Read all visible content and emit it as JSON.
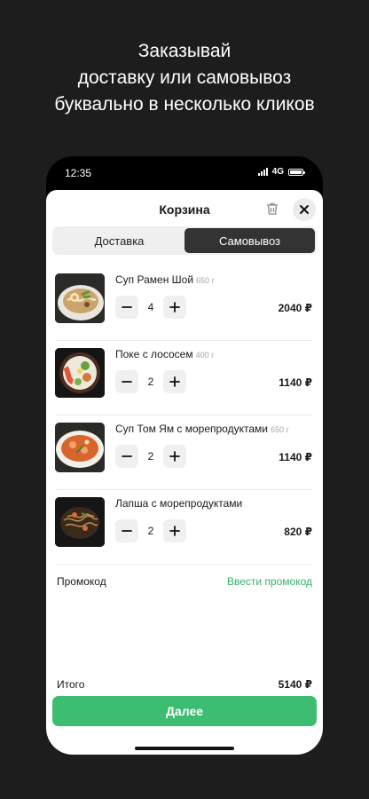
{
  "promo_headline": [
    "Заказывай",
    "доставку или самовывоз",
    "буквально в несколько кликов"
  ],
  "status_bar": {
    "time": "12:35",
    "network": "4G"
  },
  "cart": {
    "title": "Корзина",
    "tabs": [
      {
        "label": "Доставка",
        "active": false
      },
      {
        "label": "Самовывоз",
        "active": true
      }
    ],
    "items": [
      {
        "name": "Суп Рамен Шой",
        "weight": "650 г",
        "quantity": "4",
        "price": "2040 ₽",
        "image": "ramen-bowl"
      },
      {
        "name": "Поке с лососем",
        "weight": "400 г",
        "quantity": "2",
        "price": "1140 ₽",
        "image": "poke-bowl"
      },
      {
        "name": "Суп Том Ям с морепродуктами",
        "weight": "650 г",
        "quantity": "2",
        "price": "1140 ₽",
        "image": "tom-yum-bowl"
      },
      {
        "name": "Лапша с морепродуктами",
        "weight": "",
        "quantity": "2",
        "price": "820 ₽",
        "image": "noodles-plate"
      }
    ],
    "promo_label": "Промокод",
    "promo_link": "Ввести промокод",
    "total_label": "Итого",
    "total_value": "5140 ₽",
    "next_button": "Далее"
  },
  "colors": {
    "background": "#1d1d1d",
    "accent_green": "#3dbd72",
    "promo_link": "#34b366",
    "active_tab": "#333333"
  },
  "icons": {
    "trash": "trash-icon",
    "close": "close-icon",
    "minus": "minus-icon",
    "plus": "plus-icon"
  }
}
